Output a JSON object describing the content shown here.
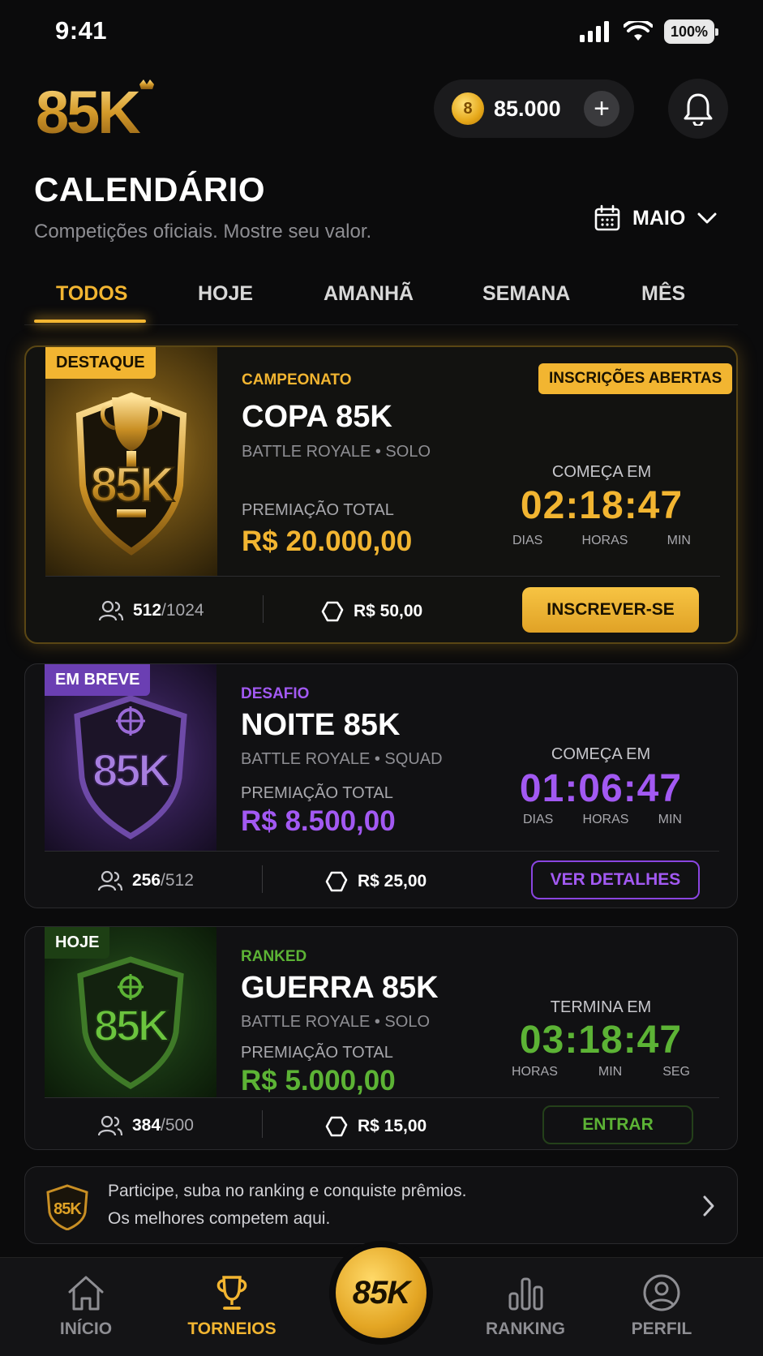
{
  "status_bar": {
    "time": "9:41",
    "battery": "100%"
  },
  "header": {
    "logo_text": "85K",
    "coin_symbol": "8",
    "coins": "85.000",
    "plus": "+"
  },
  "page": {
    "title": "CALENDÁRIO",
    "subtitle": "Competições oficiais. Mostre seu valor.",
    "month": "MAIO"
  },
  "tabs": [
    {
      "label": "TODOS",
      "active": true
    },
    {
      "label": "HOJE"
    },
    {
      "label": "AMANHÃ"
    },
    {
      "label": "SEMANA"
    },
    {
      "label": "MÊS"
    }
  ],
  "tournaments": [
    {
      "tag": "DESTAQUE",
      "category": "CAMPEONATO",
      "status": "INSCRIÇÕES ABERTAS",
      "name": "COPA 85K",
      "mode": "BATTLE ROYALE • SOLO",
      "prize_label": "PREMIAÇÃO TOTAL",
      "prize": "R$ 20.000,00",
      "countdown_label": "COMEÇA EM",
      "countdown": "02:18:47",
      "units": [
        "DIAS",
        "HORAS",
        "MIN"
      ],
      "players": "512",
      "max_players": "/1024",
      "fee": "R$ 50,00",
      "action": "INSCREVER-SE",
      "accent": "#f2b531"
    },
    {
      "tag": "EM BREVE",
      "category": "DESAFIO",
      "name": "NOITE 85K",
      "mode": "BATTLE ROYALE • SQUAD",
      "prize_label": "PREMIAÇÃO TOTAL",
      "prize": "R$ 8.500,00",
      "countdown_label": "COMEÇA EM",
      "countdown": "01:06:47",
      "units": [
        "DIAS",
        "HORAS",
        "MIN"
      ],
      "players": "256",
      "max_players": "/512",
      "fee": "R$ 25,00",
      "action": "VER DETALHES",
      "accent": "#a259f2"
    },
    {
      "tag": "HOJE",
      "category": "RANKED",
      "name": "GUERRA 85K",
      "mode": "BATTLE ROYALE • SOLO",
      "prize_label": "PREMIAÇÃO TOTAL",
      "prize": "R$ 5.000,00",
      "countdown_label": "TERMINA EM",
      "countdown": "03:18:47",
      "units": [
        "HORAS",
        "MIN",
        "SEG"
      ],
      "players": "384",
      "max_players": "/500",
      "fee": "R$ 15,00",
      "action": "ENTRAR",
      "accent": "#5cb335"
    }
  ],
  "banner": {
    "line1": "Participe, suba no ranking e conquiste prêmios.",
    "line2": "Os melhores competem aqui."
  },
  "nav": {
    "home": "INÍCIO",
    "tournaments": "TORNEIOS",
    "center": "85K",
    "ranking": "RANKING",
    "profile": "PERFIL"
  }
}
